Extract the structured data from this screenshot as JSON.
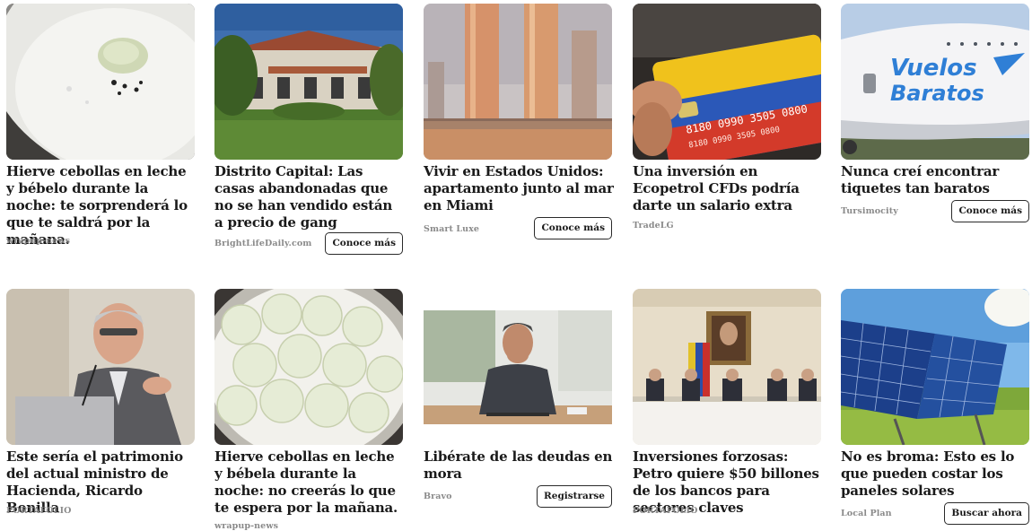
{
  "cards": [
    {
      "title": "Hierve cebollas en leche y bébelo durante la noche: te sorprenderá lo que te saldrá por la mañana.",
      "source": "wrapup-news",
      "cta": null
    },
    {
      "title": "Distrito Capital: Las casas abandonadas que no se han vendido están a precio de gang",
      "source": "BrightLifeDaily.com",
      "cta": "Conoce más"
    },
    {
      "title": "Vivir en Estados Unidos: apartamento junto al mar en Miami",
      "source": "Smart Luxe",
      "cta": "Conoce más"
    },
    {
      "title": "Una inversión en Ecopetrol CFDs podría darte un salario extra",
      "source": "TradeLG",
      "cta": null
    },
    {
      "title": "Nunca creí encontrar tiquetes tan baratos",
      "source": "Tursimocity",
      "cta": "Conoce más"
    },
    {
      "title": "Este sería el patrimonio del actual ministro de Hacienda, Ricardo Bonilla",
      "source": "PORTAFOLIO",
      "cta": null
    },
    {
      "title": "Hierve cebollas en leche y bébela durante la noche: no creerás lo que te espera por la mañana.",
      "source": "wrapup-news",
      "cta": null
    },
    {
      "title": "Libérate de las deudas en mora",
      "source": "Bravo",
      "cta": "Registrarse"
    },
    {
      "title": "Inversiones forzosas: Petro quiere $50 billones de los bancos para sectores claves",
      "source": "PORTAFOLIO",
      "cta": null
    },
    {
      "title": "No es broma: Esto es lo que pueden costar los paneles solares",
      "source": "Local Plan",
      "cta": "Buscar ahora"
    }
  ],
  "images": {
    "card4_card_number_line1": "8180 0990 3505 0800",
    "card4_card_number_line2": "8180 0990 3505 0800",
    "card5_logo_line1": "Vuelos",
    "card5_logo_line2": "Baratos"
  },
  "colors": {
    "title_text": "#1a1a1a",
    "source_text": "#8a8a8a",
    "button_border": "#2a2a2a",
    "logo_blue": "#2f7fd6"
  }
}
